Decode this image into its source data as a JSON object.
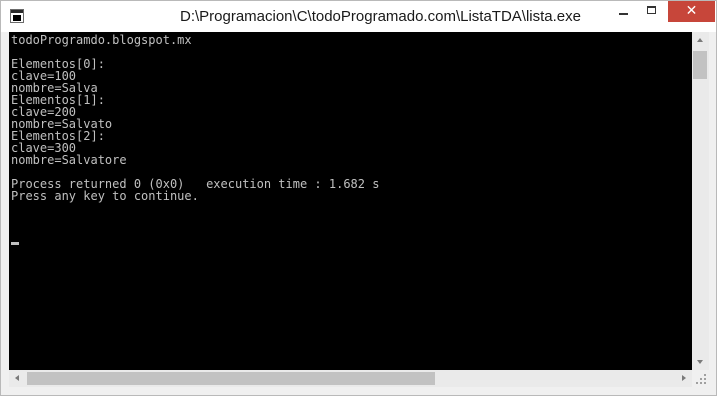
{
  "window": {
    "title": "D:\\Programacion\\C\\todoProgramado.com\\ListaTDA\\lista.exe",
    "close_glyph": "✕"
  },
  "console": {
    "lines": [
      "todoProgramdo.blogspot.mx",
      "",
      "Elementos[0]:",
      "clave=100",
      "nombre=Salva",
      "Elementos[1]:",
      "clave=200",
      "nombre=Salvato",
      "Elementos[2]:",
      "clave=300",
      "nombre=Salvatore",
      "",
      "Process returned 0 (0x0)   execution time : 1.682 s",
      "Press any key to continue."
    ]
  },
  "colors": {
    "console_bg": "#000000",
    "console_fg": "#c0c0c0",
    "close_button": "#c7463a"
  },
  "icons": {
    "app": "console-app-icon",
    "minimize": "minimize-icon",
    "maximize": "maximize-icon",
    "close": "close-icon"
  }
}
